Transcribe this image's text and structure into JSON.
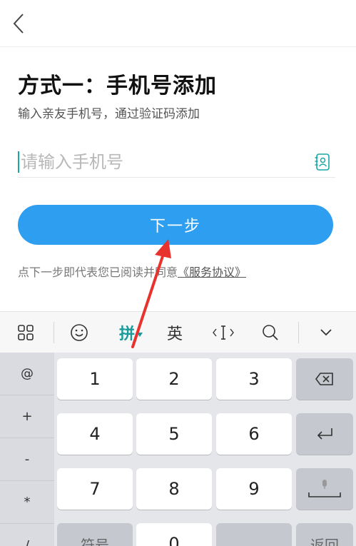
{
  "page": {
    "title": "方式一：手机号添加",
    "subtitle": "输入亲友手机号，通过验证码添加"
  },
  "phone": {
    "placeholder": "请输入手机号",
    "value": ""
  },
  "next_button": {
    "label": "下一步"
  },
  "agreement": {
    "text": "点下一步即代表您已阅读并同意",
    "link": "《服务协议》"
  },
  "keyboard": {
    "toolbar": {
      "pinyin": "拼",
      "english": "英"
    },
    "side_keys": [
      "@",
      "+",
      "-",
      "*",
      "/"
    ],
    "keys": {
      "k1": "1",
      "k2": "2",
      "k3": "3",
      "k4": "4",
      "k5": "5",
      "k6": "6",
      "k7": "7",
      "k8": "8",
      "k9": "9",
      "symbol": "符号",
      "k0": "0",
      "return": "返回"
    }
  },
  "colors": {
    "accent": "#2e9ff0",
    "teal": "#1aa6a6",
    "arrow": "#e8322d"
  }
}
